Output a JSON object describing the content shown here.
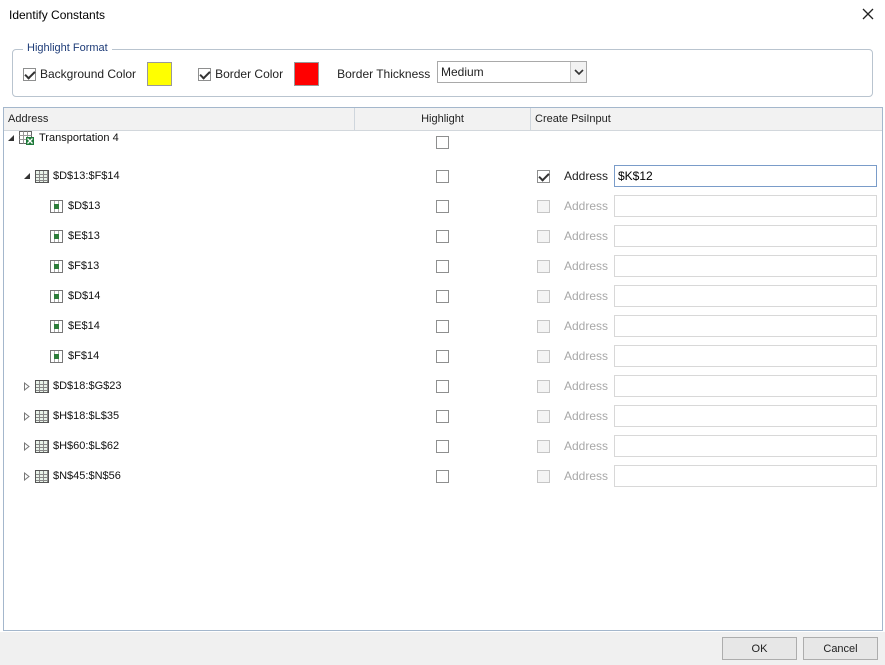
{
  "window": {
    "title": "Identify Constants"
  },
  "format": {
    "legend": "Highlight Format",
    "background_label": "Background Color",
    "background_checked": true,
    "background_color": "#ffff00",
    "border_label": "Border Color",
    "border_checked": true,
    "border_color": "#ff0000",
    "thickness_label": "Border Thickness",
    "thickness_value": "Medium"
  },
  "grid": {
    "columns": [
      "Address",
      "Highlight",
      "Create PsiInput"
    ],
    "rows": [
      {
        "label": "Transportation 4",
        "kind": "workbook",
        "expander": "expanded",
        "highlight": false,
        "psi": null
      },
      {
        "label": "$D$13:$F$14",
        "kind": "range",
        "expander": "expanded",
        "highlight": false,
        "psi": {
          "checked": true,
          "enabled": true,
          "label": "Address",
          "value": "$K$12"
        }
      },
      {
        "label": "$D$13",
        "kind": "cell",
        "expander": "none",
        "highlight": false,
        "psi": {
          "checked": false,
          "enabled": false,
          "label": "Address",
          "value": ""
        }
      },
      {
        "label": "$E$13",
        "kind": "cell",
        "expander": "none",
        "highlight": false,
        "psi": {
          "checked": false,
          "enabled": false,
          "label": "Address",
          "value": ""
        }
      },
      {
        "label": "$F$13",
        "kind": "cell",
        "expander": "none",
        "highlight": false,
        "psi": {
          "checked": false,
          "enabled": false,
          "label": "Address",
          "value": ""
        }
      },
      {
        "label": "$D$14",
        "kind": "cell",
        "expander": "none",
        "highlight": false,
        "psi": {
          "checked": false,
          "enabled": false,
          "label": "Address",
          "value": ""
        }
      },
      {
        "label": "$E$14",
        "kind": "cell",
        "expander": "none",
        "highlight": false,
        "psi": {
          "checked": false,
          "enabled": false,
          "label": "Address",
          "value": ""
        }
      },
      {
        "label": "$F$14",
        "kind": "cell",
        "expander": "none",
        "highlight": false,
        "psi": {
          "checked": false,
          "enabled": false,
          "label": "Address",
          "value": ""
        }
      },
      {
        "label": "$D$18:$G$23",
        "kind": "range",
        "expander": "collapsed",
        "highlight": false,
        "psi": {
          "checked": false,
          "enabled": false,
          "label": "Address",
          "value": ""
        }
      },
      {
        "label": "$H$18:$L$35",
        "kind": "range",
        "expander": "collapsed",
        "highlight": false,
        "psi": {
          "checked": false,
          "enabled": false,
          "label": "Address",
          "value": ""
        }
      },
      {
        "label": "$H$60:$L$62",
        "kind": "range",
        "expander": "collapsed",
        "highlight": false,
        "psi": {
          "checked": false,
          "enabled": false,
          "label": "Address",
          "value": ""
        }
      },
      {
        "label": "$N$45:$N$56",
        "kind": "range",
        "expander": "collapsed",
        "highlight": false,
        "psi": {
          "checked": false,
          "enabled": false,
          "label": "Address",
          "value": ""
        }
      }
    ]
  },
  "footer": {
    "ok_label": "OK",
    "cancel_label": "Cancel"
  }
}
